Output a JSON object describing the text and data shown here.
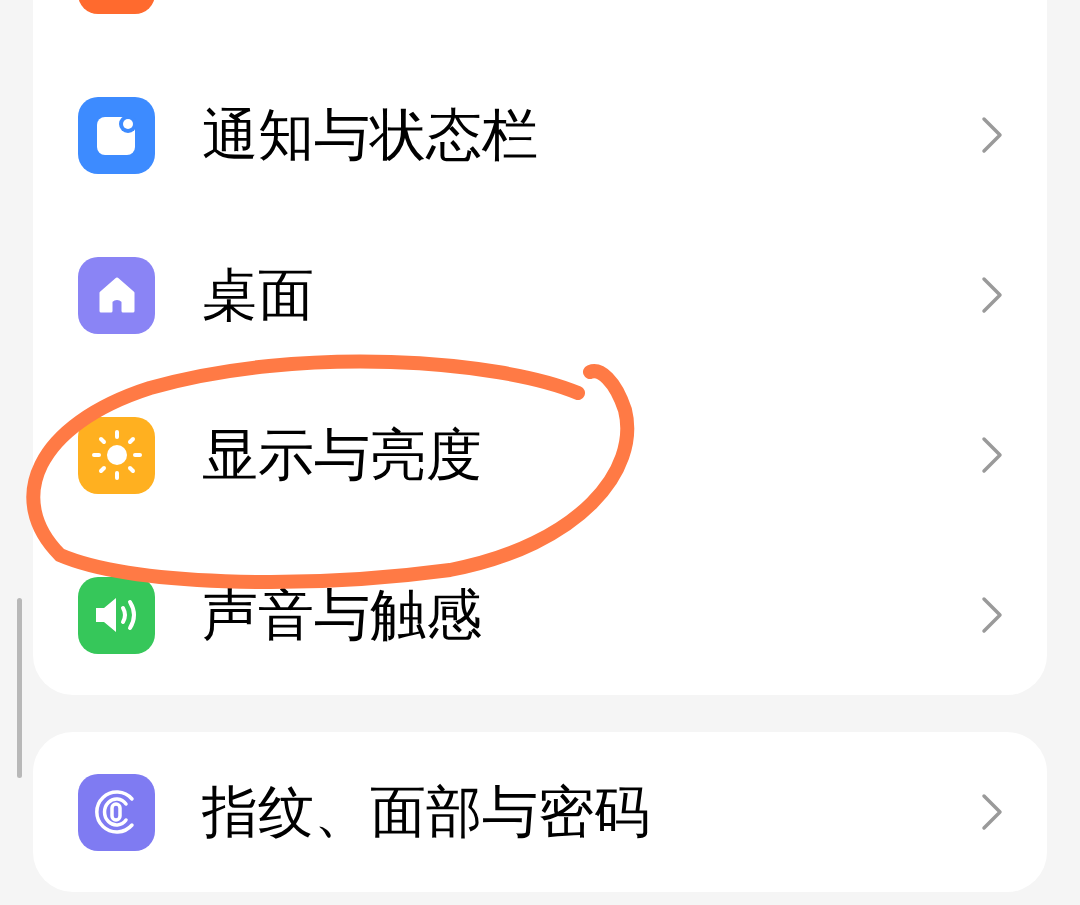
{
  "groups": [
    {
      "items": [
        {
          "label": "通知与状态栏",
          "kind": "notification"
        },
        {
          "label": "桌面",
          "kind": "home"
        },
        {
          "label": "显示与亮度",
          "kind": "display"
        },
        {
          "label": "声音与触感",
          "kind": "sound"
        }
      ]
    },
    {
      "items": [
        {
          "label": "指纹、面部与密码",
          "kind": "fingerprint"
        }
      ]
    }
  ]
}
